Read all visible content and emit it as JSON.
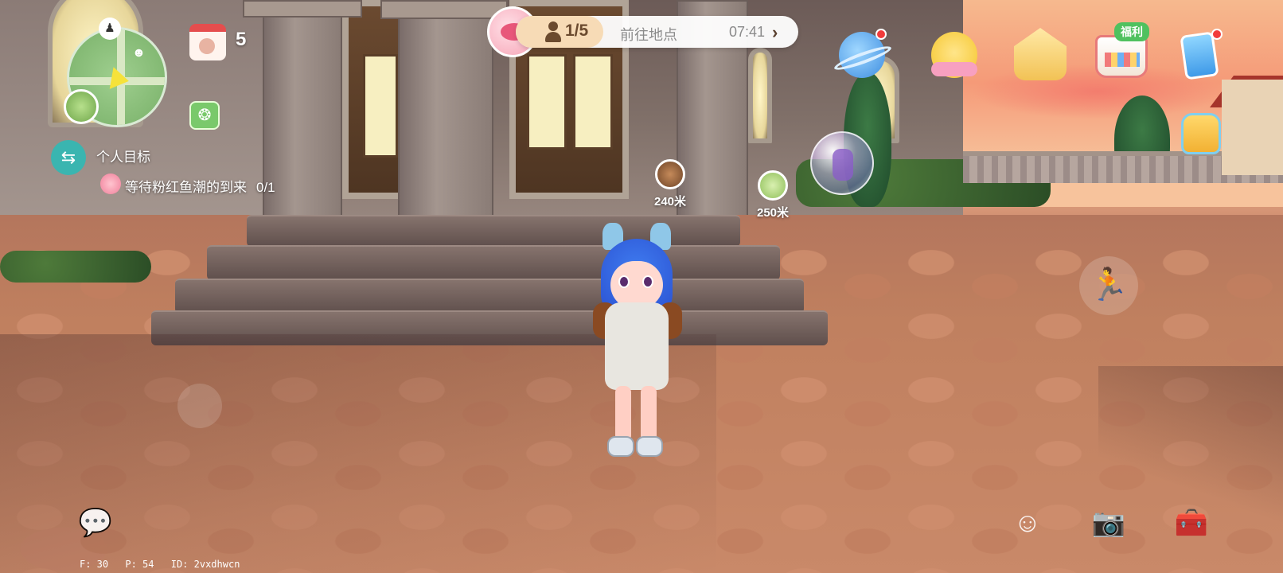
{
  "minimap": {
    "npc_icon": "npc-marker-icon",
    "player_avatar": "player-avatar"
  },
  "calendar": {
    "count": "5"
  },
  "goal": {
    "title": "个人目标",
    "task_text": "等待粉红鱼潮的到来",
    "task_progress": "0/1"
  },
  "topbar": {
    "player_count": "1/5",
    "goto_label": "前往地点",
    "timer": "07:41",
    "chevron": "›"
  },
  "top_icons": {
    "welfare_tag": "福利"
  },
  "distance_markers": [
    {
      "label": "240米"
    },
    {
      "label": "250米"
    }
  ],
  "buttons": {
    "jump": "🏃",
    "chat": "💬",
    "emote": "☺",
    "camera": "📷",
    "toolbox": "🧰",
    "goal_toggle": "⇆",
    "signal": "❂"
  },
  "debug": {
    "fps": "F: 30",
    "ping": "P: 54",
    "id": "ID: 2vxdhwcn"
  },
  "colors": {
    "accent_teal": "#3ab5b0",
    "welfare_green": "#4fc15f",
    "notification_red": "#f23b3b"
  }
}
